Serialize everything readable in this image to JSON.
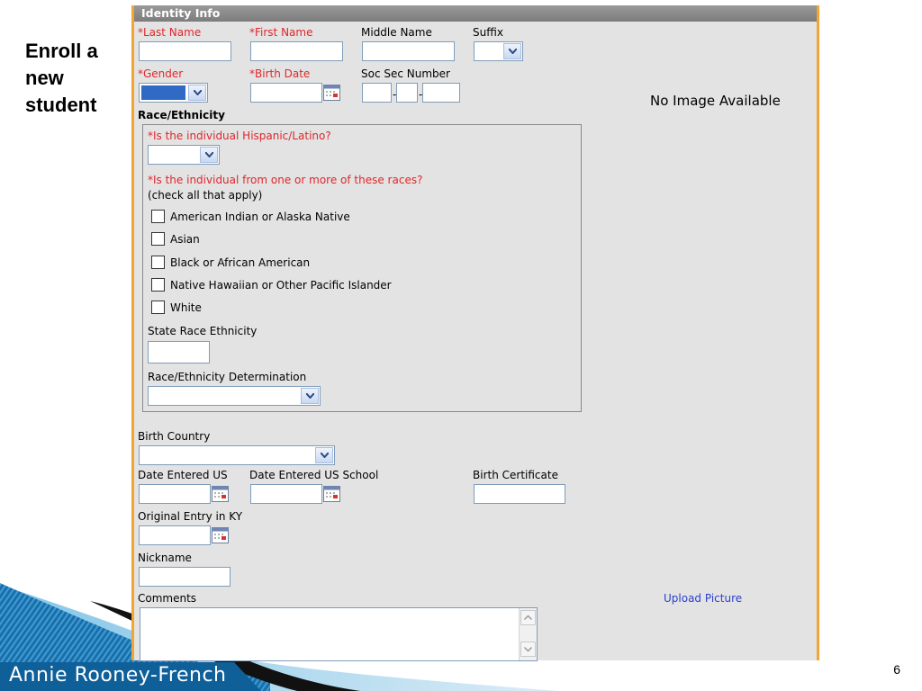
{
  "slide": {
    "title": "Enroll a new student",
    "author": "Annie Rooney-French",
    "page_number": "6"
  },
  "panel": {
    "header": "Identity Info",
    "fields": {
      "last_name": "*Last Name",
      "first_name": "*First Name",
      "middle_name": "Middle Name",
      "suffix": "Suffix",
      "gender": "*Gender",
      "birth_date": "*Birth Date",
      "ssn": "Soc Sec Number",
      "race_ethnicity": "Race/Ethnicity",
      "birth_country": "Birth Country",
      "date_entered_us": "Date Entered US",
      "date_entered_us_school": "Date Entered US School",
      "birth_certificate": "Birth Certificate",
      "original_entry_ky": "Original Entry in KY",
      "nickname": "Nickname",
      "comments": "Comments"
    },
    "race": {
      "hispanic_question": "*Is the individual Hispanic/Latino?",
      "races_question": "*Is the individual from one or more of these races?",
      "check_hint": "(check all that apply)",
      "options": [
        "American Indian or Alaska Native",
        "Asian",
        "Black or African American",
        "Native Hawaiian or Other Pacific Islander",
        "White"
      ],
      "state_race_ethnicity": "State Race Ethnicity",
      "determination": "Race/Ethnicity Determination"
    },
    "no_image": "No Image Available",
    "upload_picture": "Upload Picture"
  },
  "colors": {
    "required": "#e0262b",
    "link": "#2a3fd0",
    "panel_border": "#f2a533",
    "header_bg": "#8a8a8a",
    "selection": "#316ac5"
  }
}
